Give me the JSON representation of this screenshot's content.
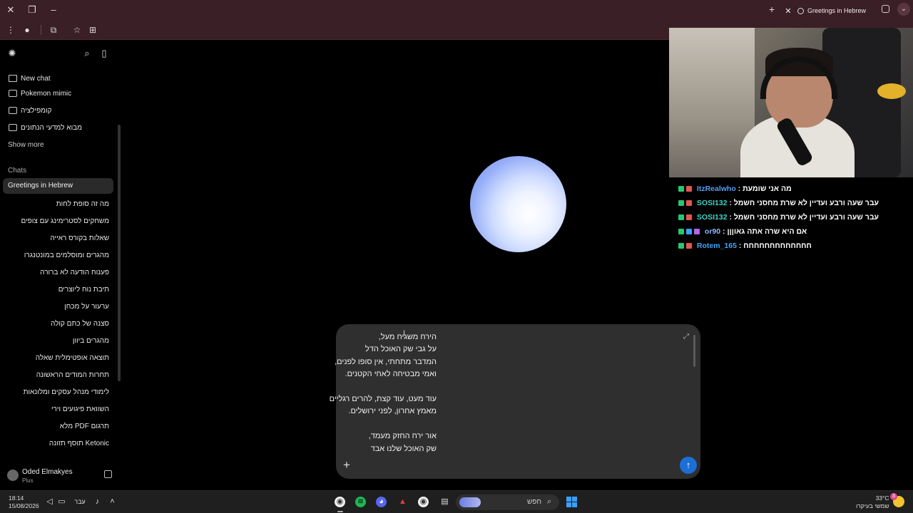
{
  "browser": {
    "tab_title": "Greetings in Hebrew"
  },
  "sidebar": {
    "projects": [
      {
        "label": "New chat"
      },
      {
        "label": "Pokemon mimic"
      },
      {
        "label": "קומפילציה"
      },
      {
        "label": "מבוא למדעי הנתונים"
      }
    ],
    "show_more": "Show more",
    "chats_heading": "Chats",
    "active_chat": "Greetings in Hebrew",
    "chats": [
      "מה זה סופת לחות",
      "משחקים לסטרימינג עם צופים",
      "שאלות בקורס ראייה",
      "מהגרים ומוסלמים במונטנגרו",
      "פענוח הודעה לא ברורה",
      "תיבת נוח ליוצרים",
      "ערעור על מכחן",
      "סצנה של כתם קולה",
      "מהגרים ביוון",
      "תוצאה אופטימלית שאלה",
      "תחרות המודים הראשונה",
      "לימודי מנהל עסקים ומלונאות",
      "השוואת פיגועים וירי",
      "תרגום PDF מלא",
      "Ketonic תוסף תזונה"
    ],
    "user": {
      "name": "Oded Elmakyes",
      "plan": "Plus"
    }
  },
  "composer": {
    "text": "הירח משגיח מעל,\nעל גבי שק האוכל הדל\nהמדבר מתחתי, אין סופו לפנים,\nואמי מבטיחה לאחי הקטנים.\n\nעוד מעט, עוד קצת, להרים רגליים\nמאמץ אחרון, לפני ירושלים.\n\nאור ירח החזק מעמד,\nשק האוכל שלנו אבד"
  },
  "stream_chat": [
    {
      "user": "ItzRealwho",
      "message": "מה אני שומעת",
      "user_color": "#5b9cf5"
    },
    {
      "user": "SOSI132",
      "message": "עבר שעה ורבע ועדיין לא שרת מחסני חשמל",
      "user_color": "#3fd3c8"
    },
    {
      "user": "SOSI132",
      "message": "עבר שעה ורבע ועדיין לא שרת מחסני חשמל",
      "user_color": "#3fd3c8"
    },
    {
      "user": "or90",
      "message": "אם היא שרה אתה גאוןןן",
      "user_color": "#8fb8ff"
    },
    {
      "user": "Rotem_165",
      "message": "חחחחחחחחחחחחח",
      "user_color": "#3aa8ff"
    }
  ],
  "taskbar": {
    "time": "18:14",
    "date": "15/08/2026",
    "language": "עבר",
    "search_label": "חפש",
    "temperature": "33°C",
    "weather_desc": "שמשי בעיקרו",
    "notification_count": "3"
  }
}
